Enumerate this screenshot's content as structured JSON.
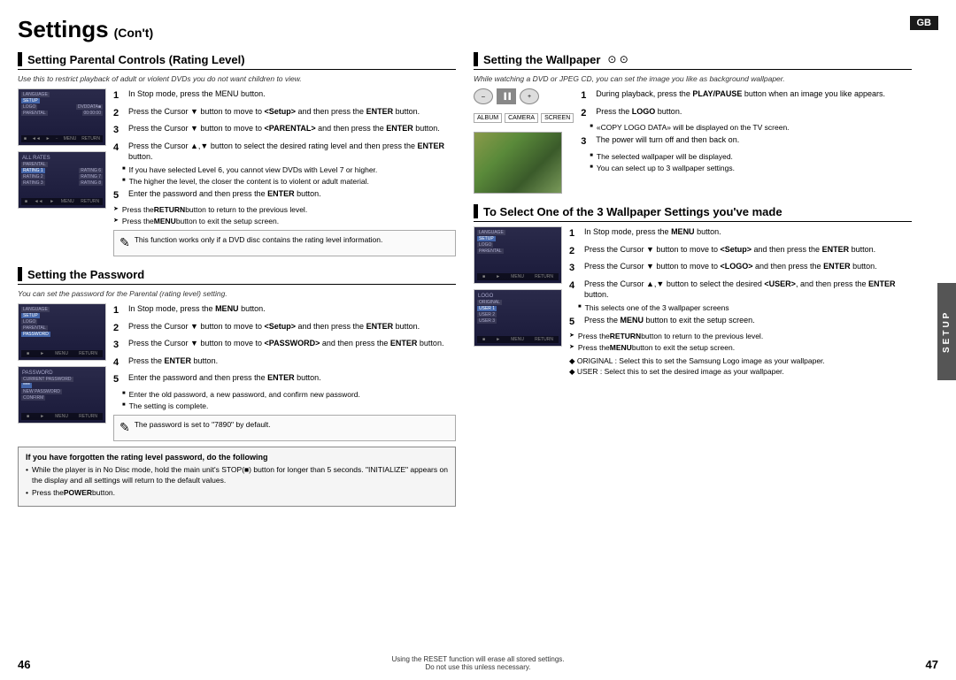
{
  "page": {
    "title": "Settings",
    "subtitle": "(Con't)",
    "gb_label": "GB",
    "page_num_left": "46",
    "page_num_right": "47",
    "footer_note_left": "Using the RESET function will erase all stored settings.",
    "footer_note_left2": "Do not use this unless necessary."
  },
  "setup_tab": "SETUP",
  "left": {
    "section1": {
      "title": "Setting Parental Controls (Rating Level)",
      "intro": "Use this to restrict playback of adult or violent DVDs you do not want children to view.",
      "steps": [
        {
          "num": "1",
          "text": "In Stop mode, press the MENU button."
        },
        {
          "num": "2",
          "text": "Press the Cursor ▼ button to move to <Setup> and then press the ENTER button."
        },
        {
          "num": "3",
          "text": "Press the Cursor ▼ button to move to <PARENTAL> and then press the ENTER button."
        },
        {
          "num": "4",
          "text": "Press the Cursor ▲,▼ button to select the desired rating level and then press the ENTER button."
        },
        {
          "num": "5",
          "text": "Enter the password and then press the ENTER button."
        }
      ],
      "bullets4": [
        "If you have selected Level 6, you cannot view DVDs with Level 7 or higher.",
        "The higher the level, the closer the content is to violent or adult material."
      ],
      "arrows": [
        "Press the RETURN button to return to the previous level.",
        "Press the MENU button to exit the setup screen."
      ],
      "note": "This function works only if a DVD disc contains the rating level information."
    },
    "section2": {
      "title": "Setting the Password",
      "intro": "You can set the password for the Parental (rating level) setting.",
      "steps": [
        {
          "num": "1",
          "text": "In Stop mode, press the MENU button."
        },
        {
          "num": "2",
          "text": "Press the Cursor ▼ button to move to <Setup> and then press the ENTER button."
        },
        {
          "num": "3",
          "text": "Press the Cursor ▼ button to move to <PASSWORD> and then press the ENTER button."
        },
        {
          "num": "4",
          "text": "Press the ENTER button."
        },
        {
          "num": "5",
          "text": "Enter the password and then press the ENTER button."
        }
      ],
      "bullets5": [
        "Enter the old password, a new password, and confirm new password.",
        "The setting is complete."
      ],
      "note": "The password is set to \"7890\" by default."
    },
    "warning": {
      "title": "If you have forgotten the rating level password, do the following",
      "bullets": [
        "While the player is in No Disc mode, hold the main unit's STOP(■) button for longer than 5 seconds. \"INITIALIZE\" appears on the display and all settings will return to the default values.",
        "Press the POWER button."
      ]
    }
  },
  "right": {
    "section1": {
      "title": "Setting the Wallpaper",
      "intro": "While watching a DVD or JPEG CD, you can set the image you like as background wallpaper.",
      "steps": [
        {
          "num": "1",
          "text": "During playback, press the PLAY/PAUSE button when an image you like appears."
        },
        {
          "num": "2",
          "text": "Press the LOGO button."
        },
        {
          "num": "3",
          "text": "The power will turn off and then back on."
        }
      ],
      "bullets3": [
        "«COPY LOGO DATA» will be displayed on the TV screen.",
        "The selected wallpaper will be displayed.",
        "You can select up to 3 wallpaper settings."
      ]
    },
    "section2": {
      "title": "To Select One of the 3 Wallpaper Settings you've made",
      "steps": [
        {
          "num": "1",
          "text": "In Stop mode, press the MENU button."
        },
        {
          "num": "2",
          "text": "Press the Cursor ▼ button to move to <Setup> and then press the ENTER button."
        },
        {
          "num": "3",
          "text": "Press the Cursor ▼ button to move to <LOGO> and then press the ENTER button."
        },
        {
          "num": "4",
          "text": "Press the Cursor ▲,▼ button to select the desired <USER>, and then press the ENTER button."
        },
        {
          "num": "5",
          "text": "Press the MENU button to exit the setup screen."
        }
      ],
      "bullets4": [
        "This selects one of the 3 wallpaper screens"
      ],
      "arrows": [
        "Press the RETURN button to return to the previous level.",
        "Press the MENU button to exit the setup screen."
      ],
      "extras": [
        "ORIGINAL : Select this to set the Samsung Logo image as your wallpaper.",
        "USER : Select this to set the desired image as your wallpaper."
      ]
    }
  }
}
